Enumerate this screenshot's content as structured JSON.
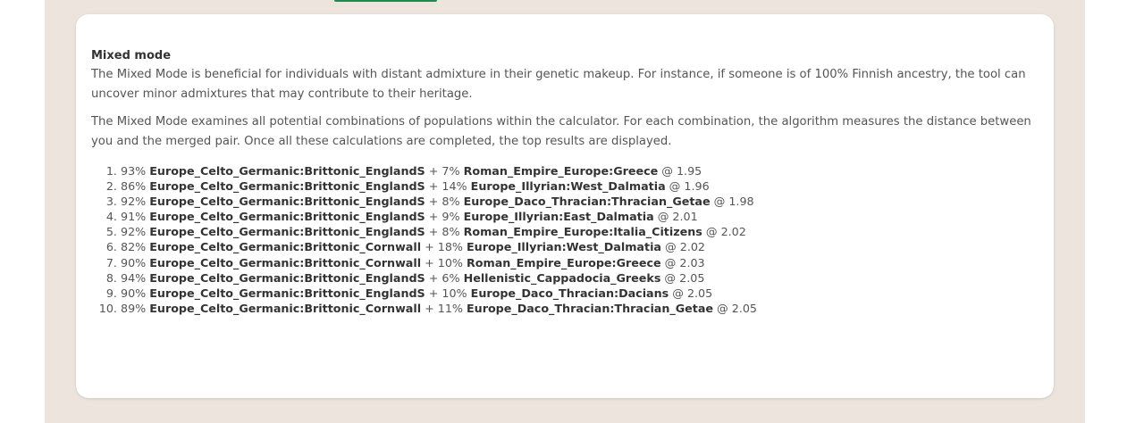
{
  "section": {
    "title": "Mixed mode",
    "paragraphs": [
      "The Mixed Mode is beneficial for individuals with distant admixture in their genetic makeup. For instance, if someone is of 100% Finnish ancestry, the tool can uncover minor admixtures that may contribute to their heritage.",
      "The Mixed Mode examines all potential combinations of populations within the calculator. For each combination, the algorithm measures the distance between you and the merged pair. Once all these calculations are completed, the top results are displayed."
    ]
  },
  "results": [
    {
      "p1": "93%",
      "pop1": "Europe_Celto_Germanic:Brittonic_EnglandS",
      "p2": "7%",
      "pop2": "Roman_Empire_Europe:Greece",
      "dist": "1.95"
    },
    {
      "p1": "86%",
      "pop1": "Europe_Celto_Germanic:Brittonic_EnglandS",
      "p2": "14%",
      "pop2": "Europe_Illyrian:West_Dalmatia",
      "dist": "1.96"
    },
    {
      "p1": "92%",
      "pop1": "Europe_Celto_Germanic:Brittonic_EnglandS",
      "p2": "8%",
      "pop2": "Europe_Daco_Thracian:Thracian_Getae",
      "dist": "1.98"
    },
    {
      "p1": "91%",
      "pop1": "Europe_Celto_Germanic:Brittonic_EnglandS",
      "p2": "9%",
      "pop2": "Europe_Illyrian:East_Dalmatia",
      "dist": "2.01"
    },
    {
      "p1": "92%",
      "pop1": "Europe_Celto_Germanic:Brittonic_EnglandS",
      "p2": "8%",
      "pop2": "Roman_Empire_Europe:Italia_Citizens",
      "dist": "2.02"
    },
    {
      "p1": "82%",
      "pop1": "Europe_Celto_Germanic:Brittonic_Cornwall",
      "p2": "18%",
      "pop2": "Europe_Illyrian:West_Dalmatia",
      "dist": "2.02"
    },
    {
      "p1": "90%",
      "pop1": "Europe_Celto_Germanic:Brittonic_Cornwall",
      "p2": "10%",
      "pop2": "Roman_Empire_Europe:Greece",
      "dist": "2.03"
    },
    {
      "p1": "94%",
      "pop1": "Europe_Celto_Germanic:Brittonic_EnglandS",
      "p2": "6%",
      "pop2": "Hellenistic_Cappadocia_Greeks",
      "dist": "2.05"
    },
    {
      "p1": "90%",
      "pop1": "Europe_Celto_Germanic:Brittonic_EnglandS",
      "p2": "10%",
      "pop2": "Europe_Daco_Thracian:Dacians",
      "dist": "2.05"
    },
    {
      "p1": "89%",
      "pop1": "Europe_Celto_Germanic:Brittonic_Cornwall",
      "p2": "11%",
      "pop2": "Europe_Daco_Thracian:Thracian_Getae",
      "dist": "2.05"
    }
  ]
}
